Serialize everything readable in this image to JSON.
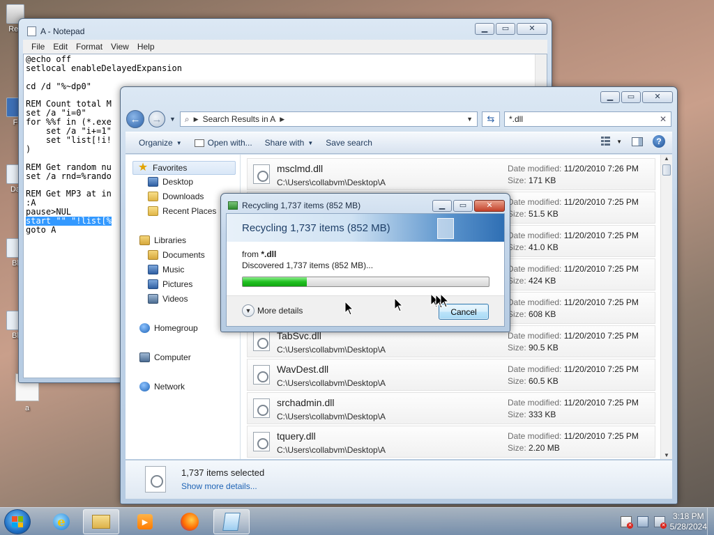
{
  "desktop": {
    "icons": [
      {
        "label": "Rec"
      },
      {
        "label": "F"
      },
      {
        "label": "Da"
      },
      {
        "label": "Bl"
      },
      {
        "label": "Bl"
      }
    ],
    "file_label": "a"
  },
  "notepad": {
    "title": "A - Notepad",
    "menu": [
      "File",
      "Edit",
      "Format",
      "View",
      "Help"
    ],
    "lines": [
      "@echo off",
      "setlocal enableDelayedExpansion",
      "",
      "cd /d \"%~dp0\"",
      "",
      "REM Count total M",
      "set /a \"i=0\"",
      "for %%f in (*.exe",
      "    set /a \"i+=1\"",
      "    set \"list[!i!",
      ")",
      "",
      "REM Get random nu",
      "set /a rnd=%rando",
      "",
      "REM Get MP3 at in",
      ":A",
      "pause>NUL",
      "start \"\" \"!list[%",
      "goto A"
    ],
    "selected_line": 18
  },
  "explorer": {
    "address": {
      "crumb": "Search Results in A"
    },
    "search_text": "*.dll",
    "toolbar": {
      "organize": "Organize",
      "open_with": "Open with...",
      "share_with": "Share with",
      "save_search": "Save search"
    },
    "nav": {
      "favorites": "Favorites",
      "desktop": "Desktop",
      "downloads": "Downloads",
      "recent_places": "Recent Places",
      "libraries": "Libraries",
      "documents": "Documents",
      "music": "Music",
      "pictures": "Pictures",
      "videos": "Videos",
      "homegroup": "Homegroup",
      "computer": "Computer",
      "network": "Network"
    },
    "meta_labels": {
      "date_modified": "Date modified:",
      "size": "Size:"
    },
    "files": [
      {
        "name": "msclmd.dll",
        "path": "C:\\Users\\collabvm\\Desktop\\A",
        "date": "11/20/2010 7:26 PM",
        "size": "171 KB"
      },
      {
        "name": "",
        "path": "",
        "date": "11/20/2010 7:25 PM",
        "size": "51.5 KB"
      },
      {
        "name": "",
        "path": "",
        "date": "11/20/2010 7:25 PM",
        "size": "41.0 KB"
      },
      {
        "name": "",
        "path": "",
        "date": "11/20/2010 7:25 PM",
        "size": "424 KB"
      },
      {
        "name": "",
        "path": "",
        "date": "11/20/2010 7:25 PM",
        "size": "608 KB"
      },
      {
        "name": "TabSvc.dll",
        "path": "C:\\Users\\collabvm\\Desktop\\A",
        "date": "11/20/2010 7:25 PM",
        "size": "90.5 KB"
      },
      {
        "name": "WavDest.dll",
        "path": "C:\\Users\\collabvm\\Desktop\\A",
        "date": "11/20/2010 7:25 PM",
        "size": "60.5 KB"
      },
      {
        "name": "srchadmin.dll",
        "path": "C:\\Users\\collabvm\\Desktop\\A",
        "date": "11/20/2010 7:25 PM",
        "size": "333 KB"
      },
      {
        "name": "tquery.dll",
        "path": "C:\\Users\\collabvm\\Desktop\\A",
        "date": "11/20/2010 7:25 PM",
        "size": "2.20 MB"
      }
    ],
    "details": {
      "count": "1,737 items selected",
      "link": "Show more details..."
    }
  },
  "dialog": {
    "title": "Recycling 1,737 items (852 MB)",
    "header": "Recycling 1,737 items (852 MB)",
    "from_prefix": "from ",
    "from_target": "*.dll",
    "discovered": "Discovered 1,737 items (852 MB)...",
    "progress": 0.26,
    "more_details": "More details",
    "cancel": "Cancel"
  },
  "taskbar": {
    "clock_time": "3:18 PM",
    "clock_date": "5/28/2024"
  },
  "colors": {
    "progress": "#22c122",
    "link": "#1f64b5",
    "selection": "#3399ff"
  },
  "icons": [
    "recycle-bin-icon",
    "notepad-icon",
    "back-icon",
    "forward-icon",
    "search-icon",
    "refresh-icon",
    "star-icon",
    "folder-icon",
    "network-icon",
    "computer-icon",
    "homegroup-icon",
    "help-icon",
    "dll-file-icon",
    "ie-icon",
    "firefox-icon",
    "media-player-icon",
    "start-orb-icon"
  ]
}
